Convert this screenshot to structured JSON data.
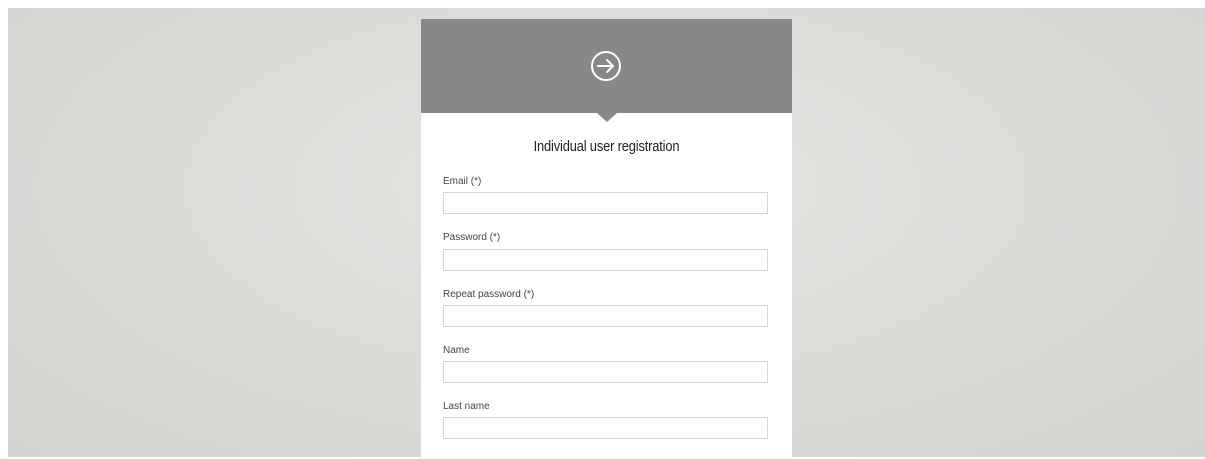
{
  "form": {
    "header_icon": "login-arrow-icon",
    "title": "Individual user registration",
    "fields": [
      {
        "label": "Email (*)",
        "value": ""
      },
      {
        "label": "Password (*)",
        "value": ""
      },
      {
        "label": "Repeat password (*)",
        "value": ""
      },
      {
        "label": "Name",
        "value": ""
      },
      {
        "label": "Last name",
        "value": ""
      }
    ]
  },
  "colors": {
    "header_bg": "#878887",
    "page_bg": "#dcdcd9",
    "card_bg": "#ffffff"
  }
}
